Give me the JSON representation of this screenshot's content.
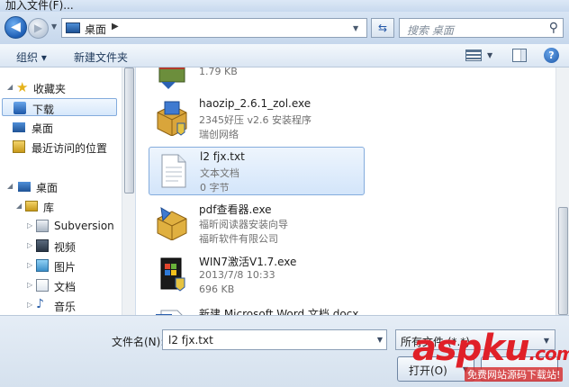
{
  "window": {
    "title": "加入文件(F)..."
  },
  "navigation": {
    "location": "桌面",
    "search_placeholder": "搜索 桌面"
  },
  "toolbar": {
    "organize_label": "组织 ▾",
    "new_folder_label": "新建文件夹"
  },
  "sidebar": {
    "favorites_label": "收藏夹",
    "items": [
      {
        "label": "下载",
        "selected": true
      },
      {
        "label": "桌面"
      },
      {
        "label": "最近访问的位置"
      }
    ],
    "desktop_label": "桌面",
    "library_label": "库",
    "library_items": [
      {
        "label": "Subversion"
      },
      {
        "label": "视频"
      },
      {
        "label": "图片"
      },
      {
        "label": "文档"
      },
      {
        "label": "音乐"
      }
    ]
  },
  "files": [
    {
      "name": "",
      "line2": "1.79 KB",
      "line3": "",
      "icon": "archive-icon"
    },
    {
      "name": "haozip_2.6.1_zol.exe",
      "line2": "2345好压 v2.6 安装程序",
      "line3": "瑞创网络",
      "icon": "installer-box-icon"
    },
    {
      "name": "l2 fjx.txt",
      "line2": "文本文档",
      "line3": "0 字节",
      "icon": "text-document-icon",
      "selected": true
    },
    {
      "name": "pdf查看器.exe",
      "line2": "福昕阅读器安装向导",
      "line3": "福昕软件有限公司",
      "icon": "installer-box-icon"
    },
    {
      "name": "WIN7激活V1.7.exe",
      "line2": "2013/7/8 10:33",
      "line3": "696 KB",
      "icon": "win7-box-icon"
    },
    {
      "name": "新建 Microsoft Word 文档.docx",
      "line2": "",
      "line3": "",
      "icon": "word-document-icon"
    }
  ],
  "footer": {
    "filename_label": "文件名(N):",
    "filename_value": "l2 fjx.txt",
    "filetype_value": "所有文件 (*.*)",
    "open_label": "打开(O)"
  },
  "watermark": {
    "brand": "aspku",
    "suffix": ".com",
    "tagline": "免费网站源码下载站!"
  },
  "colors": {
    "selection_border": "#84acdd",
    "accent_blue": "#1f5fb5",
    "watermark_red": "#e02028"
  }
}
